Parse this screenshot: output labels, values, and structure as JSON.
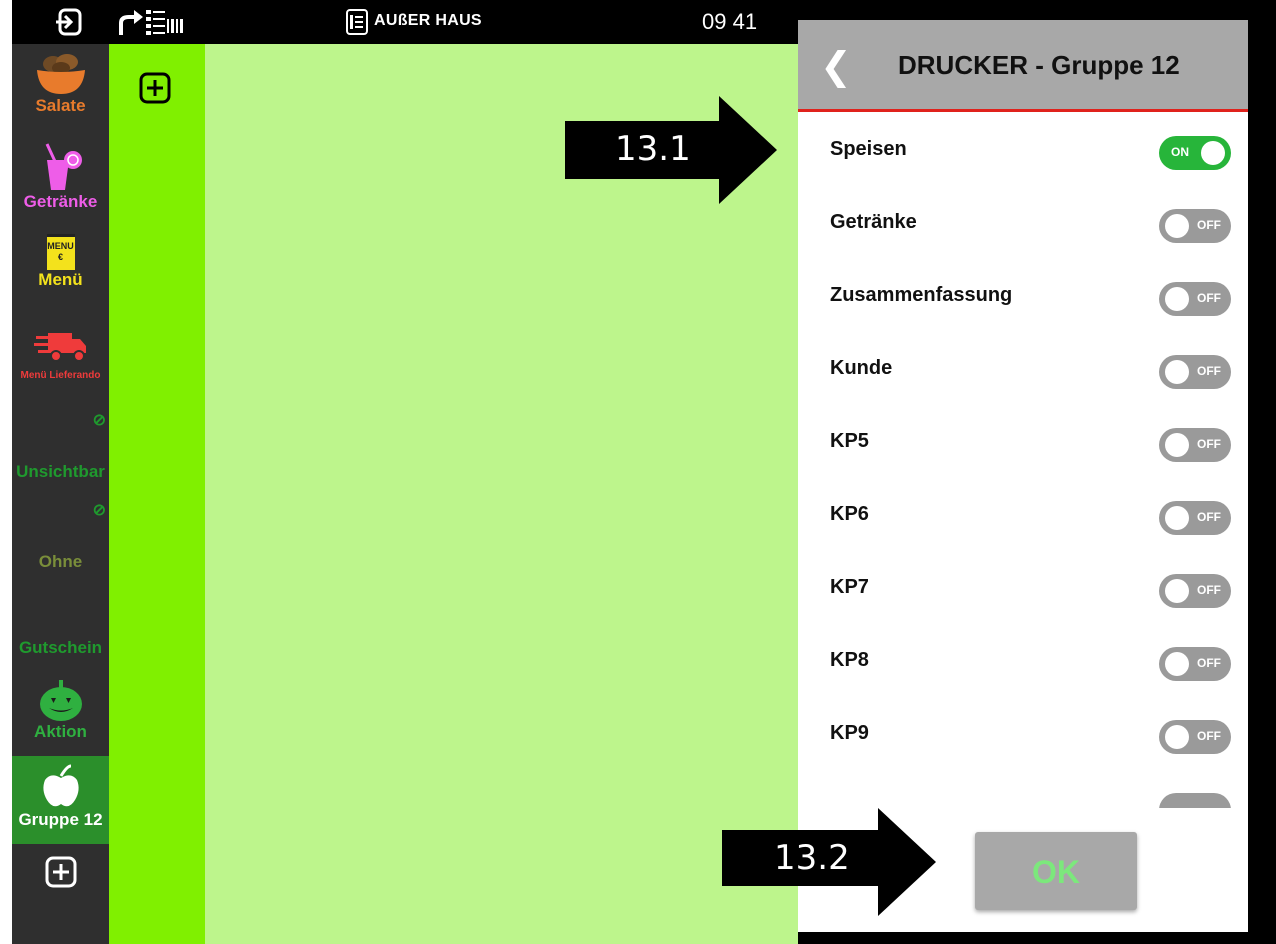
{
  "topbar": {
    "mode_label": "AUßER HAUS",
    "clock": "09 41",
    "icons": [
      "exit-icon",
      "redirect-list-icon",
      "order-list-icon"
    ]
  },
  "sidebar": {
    "categories": [
      {
        "label": "Salate",
        "color": "#e87b2c",
        "icon": "salad-bowl-icon"
      },
      {
        "label": "Getränke",
        "color": "#ee5de8",
        "icon": "drink-glass-icon"
      },
      {
        "label": "Menü",
        "color": "#f3e21c",
        "icon": "menu-card-icon",
        "icon_text": "MENU €"
      },
      {
        "label": "Menü Lieferando",
        "color": "#ef3b3b",
        "icon": "delivery-truck-icon"
      },
      {
        "label": "Unsichtbar",
        "color": "#1f9a2e",
        "icon": "eye-slash-icon"
      },
      {
        "label": "Ohne",
        "color": "#7a8e3a",
        "icon": "eye-slash-icon"
      },
      {
        "label": "Gutschein",
        "color": "#1f9a2e",
        "icon": "none"
      },
      {
        "label": "Aktion",
        "color": "#2fb040",
        "icon": "pumpkin-icon"
      },
      {
        "label": "Gruppe 12",
        "color": "#ffffff",
        "icon": "apple-icon",
        "selected": true,
        "selected_bg": "#2b8f2b"
      }
    ],
    "add_icon": "plus-square-icon"
  },
  "strip": {
    "add_icon": "plus-square-icon"
  },
  "dialog": {
    "back_icon": "chevron-left-icon",
    "title": "DRUCKER - Gruppe 12",
    "rows": [
      {
        "label": "Speisen",
        "state": "ON"
      },
      {
        "label": "Getränke",
        "state": "OFF"
      },
      {
        "label": "Zusammenfassung",
        "state": "OFF"
      },
      {
        "label": "Kunde",
        "state": "OFF"
      },
      {
        "label": "KP5",
        "state": "OFF"
      },
      {
        "label": "KP6",
        "state": "OFF"
      },
      {
        "label": "KP7",
        "state": "OFF"
      },
      {
        "label": "KP8",
        "state": "OFF"
      },
      {
        "label": "KP9",
        "state": "OFF"
      }
    ],
    "ok_label": "OK"
  },
  "annotations": [
    {
      "label": "13.1"
    },
    {
      "label": "13.2"
    }
  ]
}
